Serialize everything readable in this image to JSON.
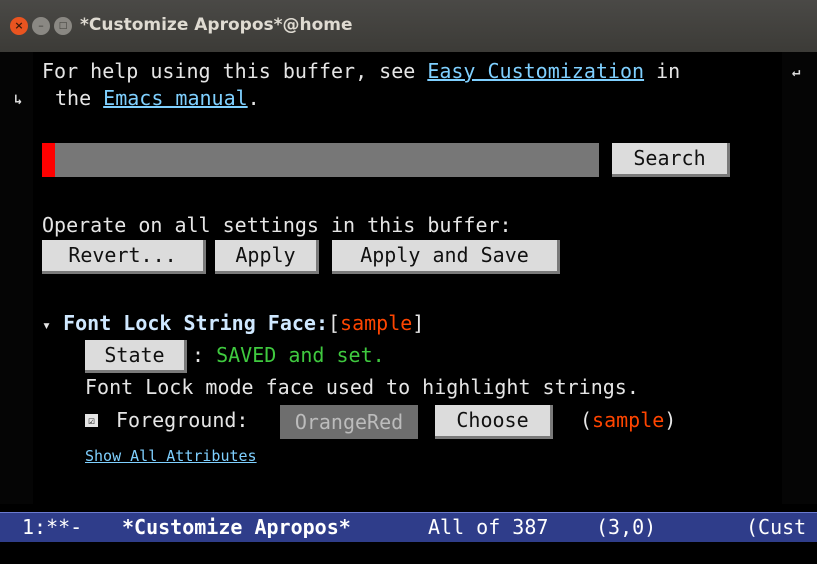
{
  "window": {
    "title": "*Customize Apropos*@home",
    "close_glyph": "×",
    "min_glyph": "–",
    "max_glyph": "□"
  },
  "fringe": {
    "right_glyph": "↵",
    "left_glyph": "↳"
  },
  "help": {
    "text_1": "For help using this buffer, see ",
    "link_1": "Easy Customization",
    "text_2": " in",
    "text_3": "the ",
    "link_2": "Emacs manual",
    "text_4": "."
  },
  "search": {
    "button_label": "Search"
  },
  "operate": {
    "label": "Operate on all settings in this buffer:",
    "revert_label": "Revert...",
    "apply_label": "Apply",
    "apply_save_label": "Apply and Save"
  },
  "face": {
    "triangle": "▾",
    "name": "Font Lock String Face",
    "colon": ":",
    "bracket_open": "[",
    "sample": "sample",
    "bracket_close": "]",
    "state_label": "State",
    "state_sep": ":",
    "state_text": "SAVED and set.",
    "description": "Font Lock mode face used to highlight strings.",
    "checkbox_mark": "☑",
    "foreground_label": "Foreground:",
    "foreground_value": "OrangeRed",
    "choose_label": "Choose",
    "paren_open": "(",
    "paren_close": ")",
    "show_all_label": "Show All Attributes"
  },
  "modeline": {
    "status": "1:**-",
    "buffer": "*Customize Apropos*",
    "position": "All of 387",
    "cursor_pos": "(3,0)",
    "mode": "(Cust"
  },
  "colors": {
    "link": "#7fd0ff",
    "sample": "#ff4500",
    "saved": "#3fc93f",
    "modeline": "#2f3d8a"
  }
}
